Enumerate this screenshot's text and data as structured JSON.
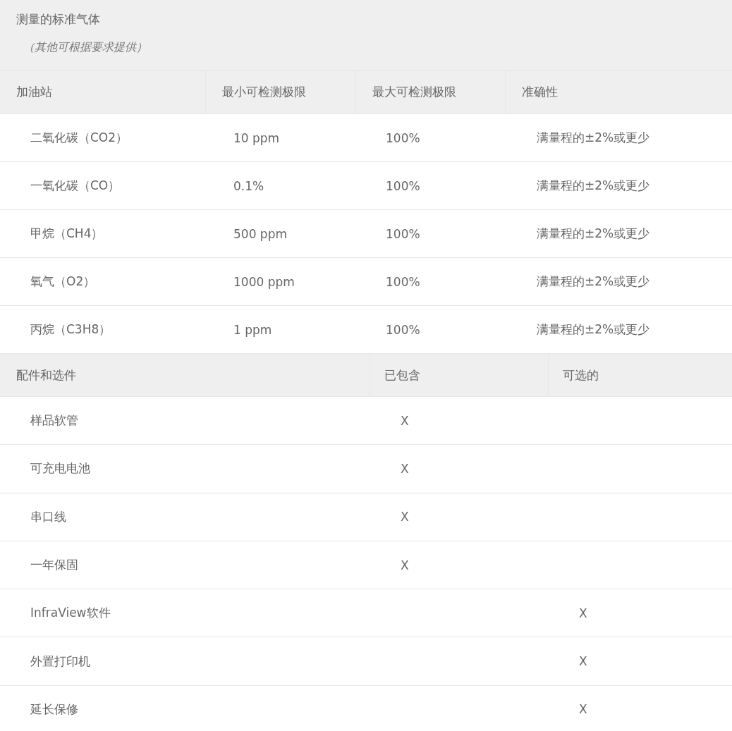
{
  "gas_table": {
    "title": "测量的标准气体",
    "note": "（其他可根据要求提供）",
    "columns": [
      "加油站",
      "最小可检测极限",
      "最大可检测极限",
      "准确性"
    ],
    "rows": [
      {
        "gas": "二氧化碳（CO2）",
        "min": "10 ppm",
        "max": "100%",
        "accuracy": "满量程的±2%或更少"
      },
      {
        "gas": "一氧化碳（CO）",
        "min": "0.1%",
        "max": "100%",
        "accuracy": "满量程的±2%或更少"
      },
      {
        "gas": "甲烷（CH4）",
        "min": "500 ppm",
        "max": "100%",
        "accuracy": "满量程的±2%或更少"
      },
      {
        "gas": "氧气（O2）",
        "min": "1000 ppm",
        "max": "100%",
        "accuracy": "满量程的±2%或更少"
      },
      {
        "gas": "丙烷（C3H8）",
        "min": "1 ppm",
        "max": "100%",
        "accuracy": "满量程的±2%或更少"
      }
    ]
  },
  "accessories_table": {
    "columns": [
      "配件和选件",
      "已包含",
      "可选的"
    ],
    "rows": [
      {
        "item": "样品软管",
        "included": "X"
      },
      {
        "item": "可充电电池",
        "included": "X"
      },
      {
        "item": "串口线",
        "included": "X"
      },
      {
        "item": "一年保固",
        "included": "X"
      },
      {
        "item": "InfraView软件",
        "optional": "X"
      },
      {
        "item": "外置打印机",
        "optional": "X"
      },
      {
        "item": "延长保修",
        "optional": "X"
      }
    ]
  }
}
